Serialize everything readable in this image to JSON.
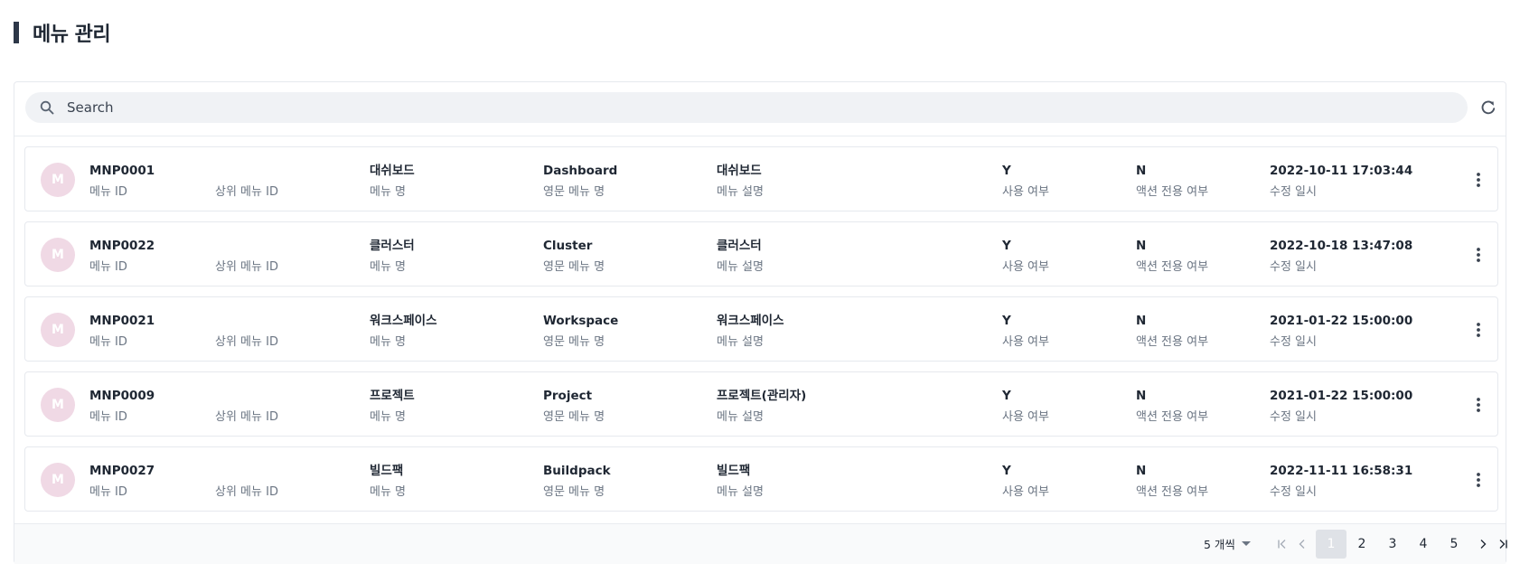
{
  "header": {
    "title": "메뉴 관리"
  },
  "search": {
    "placeholder": "Search"
  },
  "labels": {
    "menu_id": "메뉴 ID",
    "parent_menu_id": "상위 메뉴 ID",
    "menu_name": "메뉴 명",
    "english_menu_name": "영문 메뉴 명",
    "menu_description": "메뉴 설명",
    "use_flag": "사용 여부",
    "action_only_flag": "액션 전용 여부",
    "modified_at": "수정 일시"
  },
  "rows": [
    {
      "avatar": "M",
      "menu_id": "MNP0001",
      "parent_menu_id": "",
      "menu_name": "대쉬보드",
      "english_menu_name": "Dashboard",
      "menu_description": "대쉬보드",
      "use_flag": "Y",
      "action_only_flag": "N",
      "modified_at": "2022-10-11 17:03:44"
    },
    {
      "avatar": "M",
      "menu_id": "MNP0022",
      "parent_menu_id": "",
      "menu_name": "클러스터",
      "english_menu_name": "Cluster",
      "menu_description": "클러스터",
      "use_flag": "Y",
      "action_only_flag": "N",
      "modified_at": "2022-10-18 13:47:08"
    },
    {
      "avatar": "M",
      "menu_id": "MNP0021",
      "parent_menu_id": "",
      "menu_name": "워크스페이스",
      "english_menu_name": "Workspace",
      "menu_description": "워크스페이스",
      "use_flag": "Y",
      "action_only_flag": "N",
      "modified_at": "2021-01-22 15:00:00"
    },
    {
      "avatar": "M",
      "menu_id": "MNP0009",
      "parent_menu_id": "",
      "menu_name": "프로젝트",
      "english_menu_name": "Project",
      "menu_description": "프로젝트(관리자)",
      "use_flag": "Y",
      "action_only_flag": "N",
      "modified_at": "2021-01-22 15:00:00"
    },
    {
      "avatar": "M",
      "menu_id": "MNP0027",
      "parent_menu_id": "",
      "menu_name": "빌드팩",
      "english_menu_name": "Buildpack",
      "menu_description": "빌드팩",
      "use_flag": "Y",
      "action_only_flag": "N",
      "modified_at": "2022-11-11 16:58:31"
    }
  ],
  "pagination": {
    "page_size_label": "5 개씩",
    "pages": [
      "1",
      "2",
      "3",
      "4",
      "5"
    ],
    "current_page": "1"
  },
  "icons": {
    "search": "search-icon",
    "refresh": "refresh-icon",
    "more": "more-vertical-icon",
    "first": "first-page-icon",
    "prev": "prev-page-icon",
    "next": "next-page-icon",
    "last": "last-page-icon"
  },
  "colors": {
    "avatar_bg": "#f0d9e5",
    "title_bar": "#2d3748",
    "active_page_bg": "#dfe2e7"
  }
}
